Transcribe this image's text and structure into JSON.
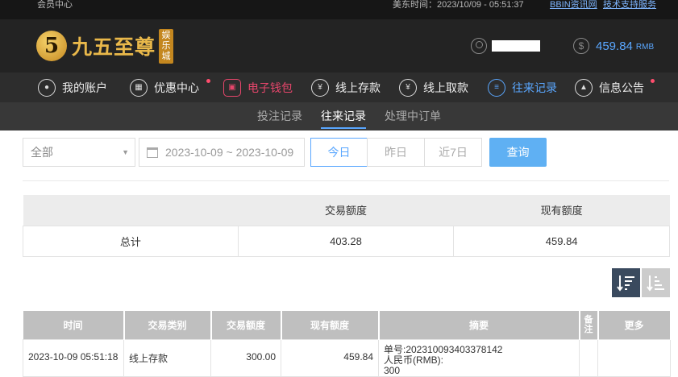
{
  "topbar": {
    "member_center": "会员中心",
    "time_label": "美东时间：2023/10/09 - 05:51:37",
    "info_link": "BBIN资讯网",
    "support_link": "技术支持服务"
  },
  "header": {
    "logo_mark": "5",
    "logo_text": "九五至尊",
    "logo_sub": "娱乐城",
    "balance": "459.84",
    "balance_unit": "RMB",
    "dollar_icon": "$"
  },
  "nav": {
    "items": [
      {
        "label": "我的账户",
        "icon": "user-icon"
      },
      {
        "label": "优惠中心",
        "icon": "gift-icon"
      },
      {
        "label": "电子钱包",
        "icon": "wallet-icon"
      },
      {
        "label": "线上存款",
        "icon": "deposit-icon"
      },
      {
        "label": "线上取款",
        "icon": "withdraw-icon"
      },
      {
        "label": "往来记录",
        "icon": "records-icon"
      },
      {
        "label": "信息公告",
        "icon": "bell-icon"
      }
    ],
    "colors": {
      "accent_red": "#e6466b",
      "accent_blue": "#5aa7ff"
    }
  },
  "subnav": {
    "items": [
      "投注记录",
      "往来记录",
      "处理中订单"
    ]
  },
  "filters": {
    "type_value": "全部",
    "date_range": "2023-10-09 ~ 2023-10-09",
    "quick_today": "今日",
    "quick_yesterday": "昨日",
    "quick_7days": "近7日",
    "search_label": "查询"
  },
  "summary": {
    "headers": [
      "",
      "交易额度",
      "现有额度"
    ],
    "row_label": "总计",
    "amount": "403.28",
    "current": "459.84"
  },
  "records": {
    "headers": [
      "时间",
      "交易类别",
      "交易额度",
      "现有额度",
      "摘要",
      "备注",
      "更多"
    ],
    "rows": [
      {
        "time": "2023-10-09 05:51:18",
        "type": "线上存款",
        "amount": "300.00",
        "current": "459.84",
        "memo_order": "单号:202310093403378142",
        "memo_currency": "人民币(RMB):",
        "memo_value": "300",
        "note": "",
        "more": ""
      }
    ]
  }
}
